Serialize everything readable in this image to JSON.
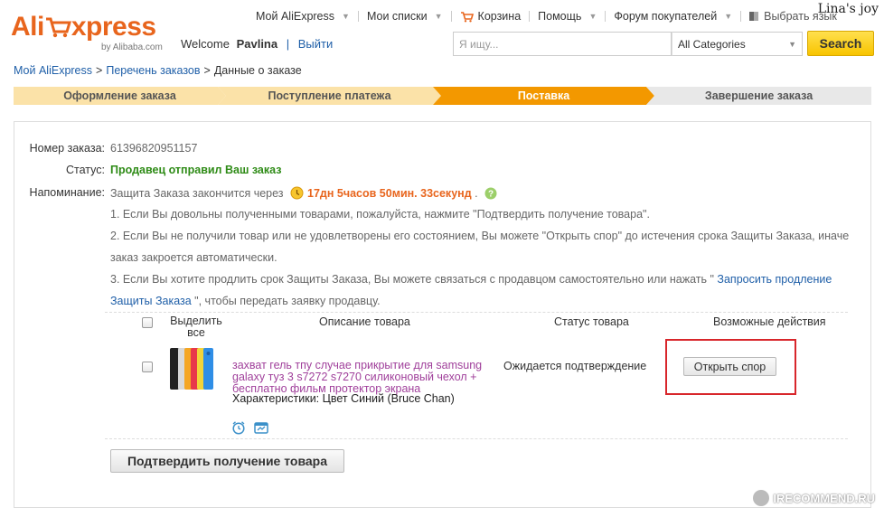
{
  "header": {
    "logo_text": "AliExpress",
    "logo_sub": "by Alibaba.com",
    "welcome_label": "Welcome",
    "username": "Pavlina",
    "separator": "|",
    "logout": "Выйти",
    "nav": [
      {
        "label": "Мой AliExpress"
      },
      {
        "label": "Мои списки"
      },
      {
        "label": "Корзина"
      },
      {
        "label": "Помощь"
      },
      {
        "label": "Форум покупателей"
      },
      {
        "label": "Выбрать язык"
      }
    ],
    "watermark": "Lina's joy",
    "search_placeholder": "Я ищу...",
    "category": "All Categories",
    "search_button": "Search"
  },
  "breadcrumb": {
    "items": [
      "Мой AliExpress",
      "Перечень заказов",
      "Данные о заказе"
    ],
    "sep": ">"
  },
  "steps": [
    {
      "label": "Оформление заказа",
      "active": false
    },
    {
      "label": "Поступление платежа",
      "active": false
    },
    {
      "label": "Поставка",
      "active": true
    },
    {
      "label": "Завершение заказа",
      "active": false
    }
  ],
  "order": {
    "number_label": "Номер заказа:",
    "number": "61396820951157",
    "status_label": "Статус:",
    "status": "Продавец отправил Ваш заказ",
    "reminder_label": "Напоминание:",
    "reminder_text": "Защита Заказа закончится через",
    "timer": "17дн 5часов 50мин. 33секунд",
    "timer_dot": ".",
    "notes": {
      "n1": "1. Если Вы довольны полученными товарами, пожалуйста, нажмите \"Подтвердить получение товара\".",
      "n2a": "2. Если Вы не получили товар или не удовлетворены его состоянием, Вы можете \"Открыть спор\" до истечения срока Защиты Заказа, иначе",
      "n2b": "заказ закроется автоматически.",
      "n3a_pre": "3. Если Вы хотите продлить срок Защиты Заказа, Вы можете связаться с продавцом самостоятельно или нажать \"",
      "n3a_link": " Запросить продление",
      "n3b_link": "Защиты Заказа",
      "n3b_post": " \", чтобы передать заявку продавцу."
    }
  },
  "table": {
    "headers": {
      "select": "Выделить все",
      "description": "Описание товара",
      "status": "Статус товара",
      "actions": "Возможные действия"
    },
    "item": {
      "title": "захват гель тпу случае прикрытие для samsung galaxy туз 3 s7272 s7270 силиконовый чехол + бесплатно фильм протектор экрана",
      "characteristics": "Характеристики: Цвет Синий (Bruce Chan)",
      "status": "Ожидается подтверждение",
      "action": "Открыть спор"
    },
    "confirm_button": "Подтвердить получение товара"
  },
  "watermark_bottom": "IRECOMMEND.RU",
  "colors": {
    "brand_orange": "#e8651d",
    "step_active": "#f39800",
    "step_done": "#fbe2a8",
    "step_pending": "#e8e8e8",
    "link_blue": "#1f5fa8",
    "status_green": "#2e8b16",
    "product_purple": "#a0409b",
    "highlight_red": "#d8262b"
  }
}
